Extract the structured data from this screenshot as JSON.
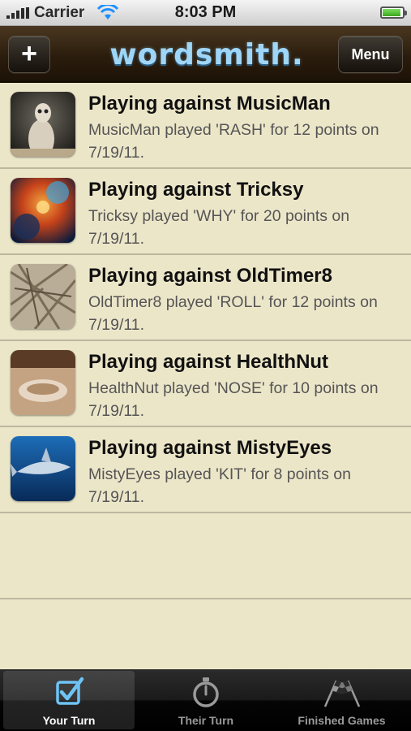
{
  "status_bar": {
    "carrier": "Carrier",
    "time": "8:03 PM",
    "battery_level": 0.92
  },
  "nav": {
    "add_label": "+",
    "logo": "wordsmith.",
    "menu_label": "Menu"
  },
  "games": [
    {
      "title": "Playing against MusicMan",
      "subtitle": "MusicMan played 'RASH' for 12 points on 7/19/11.",
      "avatar": "meerkat-avatar"
    },
    {
      "title": "Playing against Tricksy",
      "subtitle": "Tricksy played 'WHY' for 20 points on 7/19/11.",
      "avatar": "nebula-avatar"
    },
    {
      "title": "Playing against OldTimer8",
      "subtitle": "OldTimer8 played 'ROLL' for 12 points on 7/19/11.",
      "avatar": "branches-avatar"
    },
    {
      "title": "Playing against HealthNut",
      "subtitle": "HealthNut played 'NOSE' for 10 points on 7/19/11.",
      "avatar": "table-avatar"
    },
    {
      "title": "Playing against MistyEyes",
      "subtitle": "MistyEyes played 'KIT' for 8 points on 7/19/11.",
      "avatar": "shark-avatar"
    }
  ],
  "tabs": [
    {
      "label": "Your Turn",
      "icon": "checkbox-icon",
      "selected": true
    },
    {
      "label": "Their Turn",
      "icon": "stopwatch-icon",
      "selected": false
    },
    {
      "label": "Finished Games",
      "icon": "checkered-flags-icon",
      "selected": false
    }
  ],
  "colors": {
    "background": "#ece6c9",
    "nav_bar": "#2b1d0d",
    "logo": "#9fd6f7",
    "tab_selected_icon": "#6ec3f5"
  }
}
